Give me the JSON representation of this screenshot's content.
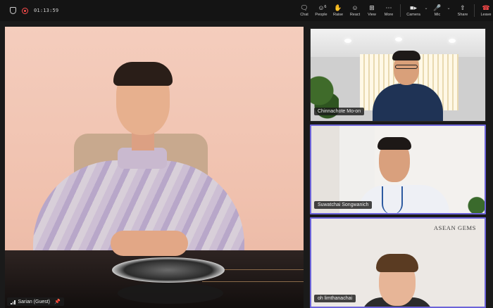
{
  "topbar": {
    "timer": "01:13:59",
    "buttons": {
      "chat": "Chat",
      "people": "People",
      "people_count": "6",
      "raise": "Raise",
      "react": "React",
      "view": "View",
      "more": "More",
      "camera": "Camera",
      "mic": "Mic",
      "share": "Share",
      "leave": "Leave"
    },
    "colors": {
      "leave": "#ff4a4a",
      "recording": "#ff4d4d"
    }
  },
  "main": {
    "name": "Sarian (Guest)"
  },
  "participants": [
    {
      "name": "Chinnachote Mo-on",
      "active": false
    },
    {
      "name": "Suwatchai Songwanich",
      "active": true
    },
    {
      "name": "oh limthanachai",
      "active": true,
      "background_text": "ASEAN GEMS"
    }
  ],
  "colors": {
    "active_border": "#6c63d9",
    "background": "#1a1a1a"
  }
}
